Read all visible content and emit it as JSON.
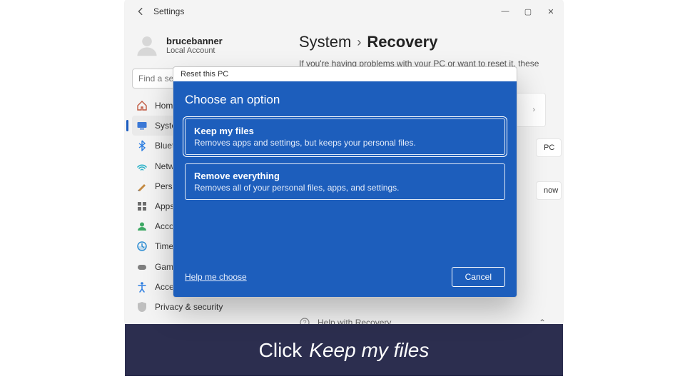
{
  "window": {
    "back_tooltip": "Back",
    "title": "Settings",
    "minimize": "—",
    "maximize": "▢",
    "close": "✕"
  },
  "account": {
    "name": "brucebanner",
    "sub": "Local Account"
  },
  "search": {
    "placeholder": "Find a setting"
  },
  "nav": {
    "items": [
      {
        "label": "Home",
        "icon": "home-icon"
      },
      {
        "label": "System",
        "icon": "system-icon"
      },
      {
        "label": "Bluetooth & devices",
        "icon": "bluetooth-icon"
      },
      {
        "label": "Network & internet",
        "icon": "network-icon"
      },
      {
        "label": "Personalization",
        "icon": "personalization-icon"
      },
      {
        "label": "Apps",
        "icon": "apps-icon"
      },
      {
        "label": "Accounts",
        "icon": "accounts-icon"
      },
      {
        "label": "Time & language",
        "icon": "time-icon"
      },
      {
        "label": "Gaming",
        "icon": "gaming-icon"
      },
      {
        "label": "Accessibility",
        "icon": "accessibility-icon"
      },
      {
        "label": "Privacy & security",
        "icon": "privacy-icon"
      }
    ]
  },
  "main": {
    "parent": "System",
    "sep": "›",
    "current": "Recovery",
    "desc": "If you're having problems with your PC or want to reset it, these recovery options",
    "pill_reset": "PC",
    "pill_restart": "now",
    "help": "Help with Recovery"
  },
  "dialog": {
    "title": "Reset this PC",
    "heading": "Choose an option",
    "options": [
      {
        "title": "Keep my files",
        "desc": "Removes apps and settings, but keeps your personal files."
      },
      {
        "title": "Remove everything",
        "desc": "Removes all of your personal files, apps, and settings."
      }
    ],
    "help": "Help me choose",
    "cancel": "Cancel"
  },
  "instruction": {
    "prefix": "Click ",
    "em": "Keep my files"
  }
}
